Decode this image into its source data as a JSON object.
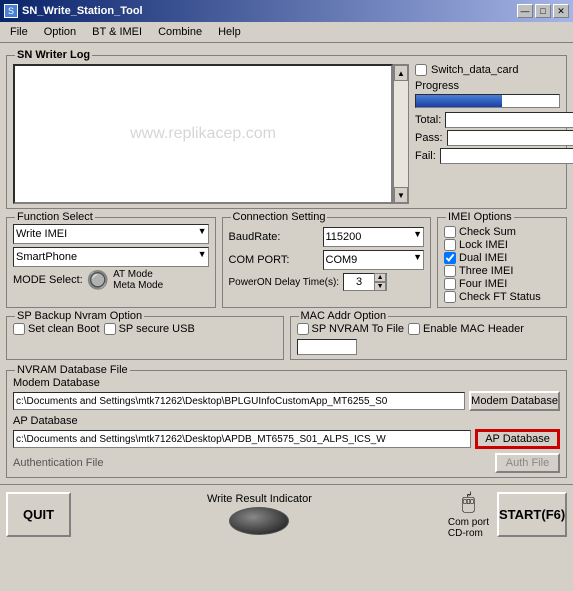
{
  "titleBar": {
    "title": "SN_Write_Station_Tool",
    "icon": "S",
    "controls": [
      "—",
      "□",
      "✕"
    ]
  },
  "menuBar": {
    "items": [
      "File",
      "Option",
      "BT & IMEI",
      "Combine",
      "Help"
    ]
  },
  "snWriterLog": {
    "title": "SN Writer Log",
    "watermark": "www.replikacep.com"
  },
  "rightPanel": {
    "switchDataCard": "Switch_data_card",
    "progressLabel": "Progress",
    "progressPercent": 60,
    "totalLabel": "Total:",
    "passLabel": "Pass:",
    "failLabel": "Fail:"
  },
  "functionSelect": {
    "title": "Function Select",
    "options": [
      "Write IMEI"
    ],
    "selected": "Write IMEI",
    "deviceOptions": [
      "SmartPhone"
    ],
    "deviceSelected": "SmartPhone",
    "modeLabel": "MODE Select:",
    "atMode": "AT Mode",
    "metaMode": "Meta Mode"
  },
  "connectionSetting": {
    "title": "Connection Setting",
    "baudRateLabel": "BaudRate:",
    "baudRateValue": "115200",
    "comPortLabel": "COM PORT:",
    "comPortValue": "COM9",
    "powerOnLabel": "PowerON Delay Time(s):",
    "powerOnValue": "3"
  },
  "imeiOptions": {
    "title": "IMEI Options",
    "checkSum": "Check Sum",
    "lockIMEI": "Lock IMEI",
    "dualIMEI": "Dual IMEI",
    "threeIMEI": "Three IMEI",
    "fourIMEI": "Four IMEI",
    "checkFTStatus": "Check FT Status",
    "dualChecked": true,
    "checkSumChecked": false,
    "lockChecked": false,
    "threeChecked": false,
    "fourChecked": false,
    "checkFTChecked": false
  },
  "spBackup": {
    "title": "SP Backup Nvram Option",
    "setCleanBoot": "Set clean Boot",
    "spSecureUSB": "SP secure USB"
  },
  "macAddr": {
    "title": "MAC Addr Option",
    "spNvramToFile": "SP NVRAM To File",
    "enableMACHeader": "Enable MAC Header"
  },
  "nvram": {
    "title": "NVRAM Database File",
    "modemLabel": "Modem Database",
    "modemPath": "c:\\Documents and Settings\\mtk71262\\Desktop\\BPLGUInfoCustomApp_MT6255_S0",
    "modemBtn": "Modem Database",
    "apLabel": "AP Database",
    "apPath": "c:\\Documents and Settings\\mtk71262\\Desktop\\APDB_MT6575_S01_ALPS_ICS_W",
    "apBtn": "AP Database",
    "authLabel": "Authentication File",
    "authBtn": "Auth File"
  },
  "bottom": {
    "quitBtn": "QUIT",
    "writeIndicatorLabel": "Write Result Indicator",
    "comPortLabel": "Com port",
    "cdRomLabel": "CD-rom",
    "startBtn": "START(F6)"
  }
}
